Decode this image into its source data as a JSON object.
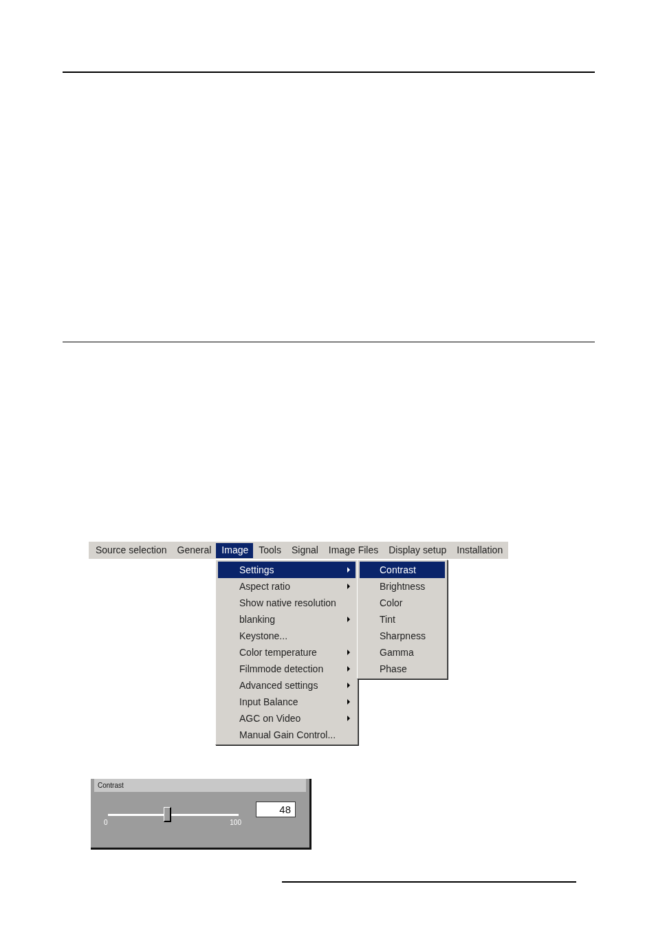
{
  "menubar": {
    "items": [
      {
        "label": "Source selection",
        "selected": false
      },
      {
        "label": "General",
        "selected": false
      },
      {
        "label": "Image",
        "selected": true
      },
      {
        "label": "Tools",
        "selected": false
      },
      {
        "label": "Signal",
        "selected": false
      },
      {
        "label": "Image Files",
        "selected": false
      },
      {
        "label": "Display setup",
        "selected": false
      },
      {
        "label": "Installation",
        "selected": false
      }
    ]
  },
  "menu": {
    "items": [
      {
        "label": "Settings",
        "submenu": true,
        "selected": true
      },
      {
        "label": "Aspect ratio",
        "submenu": true,
        "selected": false
      },
      {
        "label": "Show native resolution",
        "submenu": false,
        "selected": false
      },
      {
        "label": "blanking",
        "submenu": true,
        "selected": false
      },
      {
        "label": "Keystone...",
        "submenu": false,
        "selected": false
      },
      {
        "label": "Color temperature",
        "submenu": true,
        "selected": false
      },
      {
        "label": "Filmmode detection",
        "submenu": true,
        "selected": false
      },
      {
        "label": "Advanced settings",
        "submenu": true,
        "selected": false
      },
      {
        "label": "Input Balance",
        "submenu": true,
        "selected": false
      },
      {
        "label": "AGC on Video",
        "submenu": true,
        "selected": false
      },
      {
        "label": "Manual Gain Control...",
        "submenu": false,
        "selected": false
      }
    ]
  },
  "submenu": {
    "items": [
      {
        "label": "Contrast",
        "selected": true
      },
      {
        "label": "Brightness",
        "selected": false
      },
      {
        "label": "Color",
        "selected": false
      },
      {
        "label": "Tint",
        "selected": false
      },
      {
        "label": "Sharpness",
        "selected": false
      },
      {
        "label": "Gamma",
        "selected": false
      },
      {
        "label": "Phase",
        "selected": false
      }
    ]
  },
  "dialog": {
    "title": "Contrast",
    "min_label": "0",
    "max_label": "100",
    "level": 0.46,
    "value": "48"
  }
}
